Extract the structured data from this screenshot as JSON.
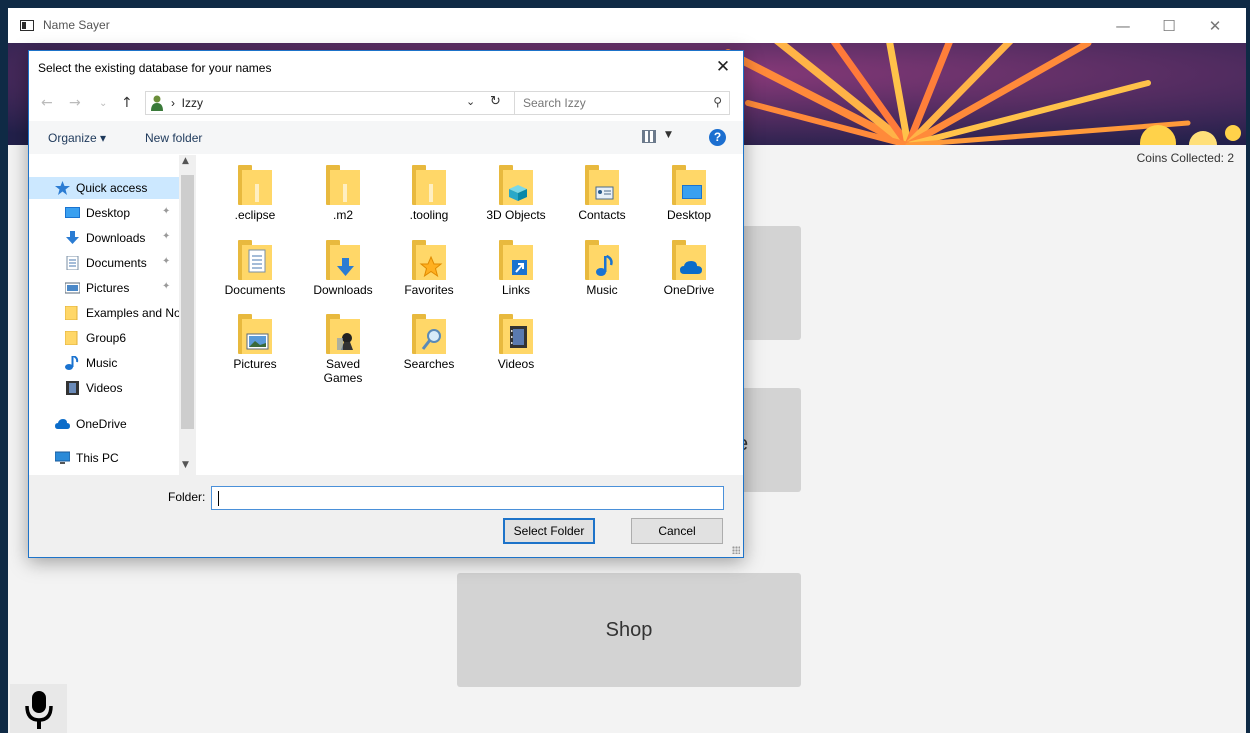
{
  "app": {
    "title": "Name Sayer",
    "coins_label": "Coins Collected: 2",
    "buttons": {
      "partial_label": "se",
      "shop_label": "Shop"
    },
    "window_controls": {
      "minimize": "—",
      "maximize": "☐",
      "close": "✕"
    }
  },
  "dialog": {
    "title": "Select the existing database for your names",
    "close": "✕",
    "address": {
      "separator": "›",
      "crumb": "Izzy"
    },
    "search": {
      "placeholder": "Search Izzy"
    },
    "toolbar": {
      "organize": "Organize ▾",
      "new_folder": "New folder",
      "help": "?"
    },
    "nav": {
      "items": [
        {
          "label": "Quick access",
          "icon": "star-icon",
          "selected": true
        },
        {
          "label": "Desktop",
          "icon": "desktop-icon",
          "pinned": true
        },
        {
          "label": "Downloads",
          "icon": "download-icon",
          "pinned": true
        },
        {
          "label": "Documents",
          "icon": "document-icon",
          "pinned": true
        },
        {
          "label": "Pictures",
          "icon": "picture-icon",
          "pinned": true
        },
        {
          "label": "Examples and Not",
          "icon": "folder-icon"
        },
        {
          "label": "Group6",
          "icon": "folder-icon"
        },
        {
          "label": "Music",
          "icon": "music-note-icon"
        },
        {
          "label": "Videos",
          "icon": "film-icon"
        },
        {
          "label": "OneDrive",
          "icon": "cloud-icon"
        },
        {
          "label": "This PC",
          "icon": "monitor-icon"
        }
      ]
    },
    "folders": [
      {
        "label": ".eclipse",
        "icon": "folder-icon"
      },
      {
        "label": ".m2",
        "icon": "folder-icon"
      },
      {
        "label": ".tooling",
        "icon": "folder-icon"
      },
      {
        "label": "3D Objects",
        "icon": "cube-folder-icon"
      },
      {
        "label": "Contacts",
        "icon": "contacts-folder-icon"
      },
      {
        "label": "Desktop",
        "icon": "desktop-folder-icon"
      },
      {
        "label": "Documents",
        "icon": "documents-folder-icon"
      },
      {
        "label": "Downloads",
        "icon": "downloads-folder-icon"
      },
      {
        "label": "Favorites",
        "icon": "favorites-folder-icon"
      },
      {
        "label": "Links",
        "icon": "links-folder-icon"
      },
      {
        "label": "Music",
        "icon": "music-folder-icon"
      },
      {
        "label": "OneDrive",
        "icon": "onedrive-folder-icon"
      },
      {
        "label": "Pictures",
        "icon": "pictures-folder-icon"
      },
      {
        "label": "Saved Games",
        "icon": "saved-games-folder-icon"
      },
      {
        "label": "Searches",
        "icon": "searches-folder-icon"
      },
      {
        "label": "Videos",
        "icon": "videos-folder-icon"
      }
    ],
    "folder_field": {
      "label": "Folder:",
      "value": ""
    },
    "select_button": "Select Folder",
    "cancel_button": "Cancel"
  },
  "colors": {
    "accent": "#1d73c9",
    "folder": "#ffd768",
    "button_gray": "#d3d3d3"
  }
}
